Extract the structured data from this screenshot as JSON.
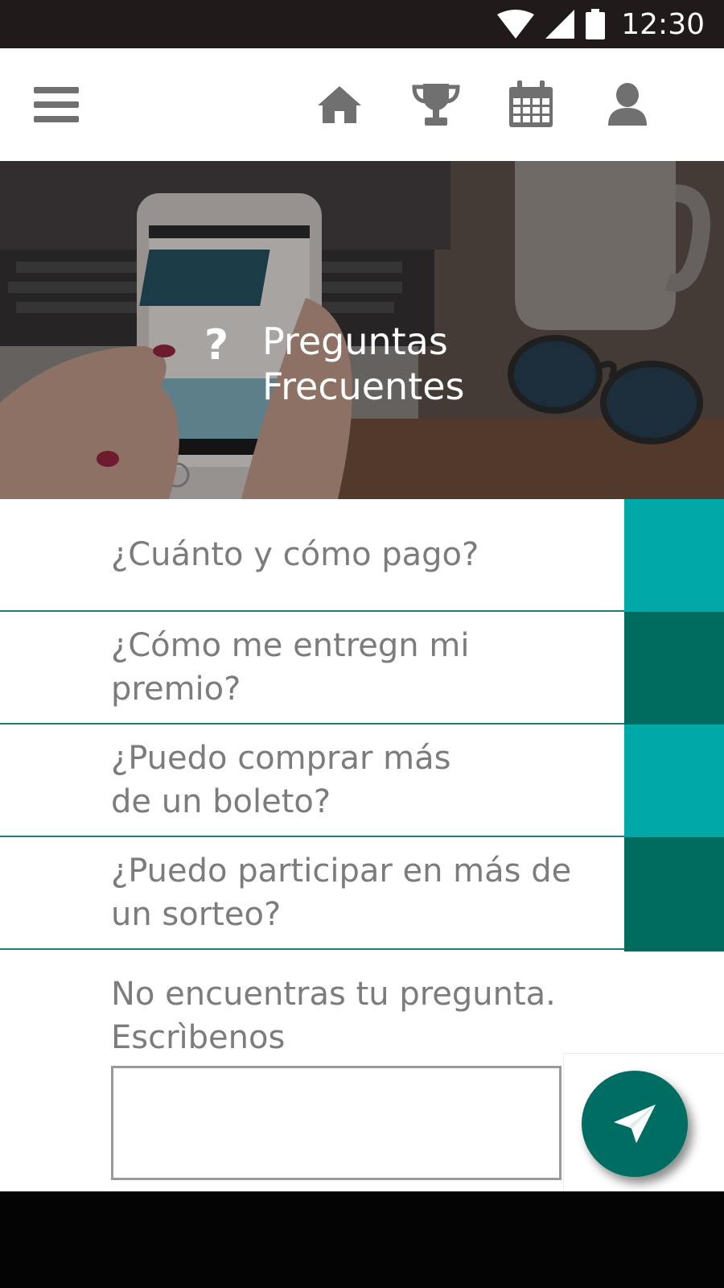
{
  "status_bar": {
    "time": "12:30",
    "icons": [
      "wifi-icon",
      "signal-icon",
      "battery-icon"
    ]
  },
  "app_bar": {
    "icons": [
      "menu-icon",
      "home-icon",
      "trophy-icon",
      "calendar-icon",
      "profile-icon"
    ]
  },
  "hero": {
    "title_line1": "Preguntas",
    "title_line2": "Frecuentes",
    "icon": "question-icon"
  },
  "faq": [
    {
      "question": "¿Cuánto y cómo pago?",
      "color": "#00a8a8"
    },
    {
      "question": "¿Cómo me entregn mi premio?",
      "color": "#006b5f"
    },
    {
      "question": "¿Puedo comprar más\nde un boleto?",
      "color": "#00a8a8"
    },
    {
      "question": "¿Puedo participar en más de\nun sorteo?",
      "color": "#006b5f"
    }
  ],
  "contact": {
    "label": "No encuentras tu pregunta.\nEscrìbenos",
    "input_value": "",
    "send_icon": "paper-plane-icon"
  },
  "colors": {
    "accent_light": "#00a8a8",
    "accent_dark": "#006b5f",
    "divider": "#1f7d74",
    "text": "#7c7c7c"
  }
}
